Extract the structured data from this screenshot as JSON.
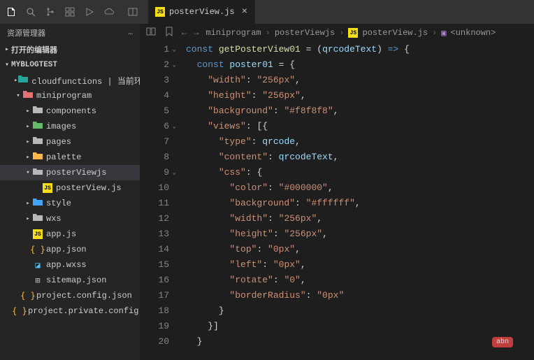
{
  "titlebar": {
    "tab_label": "posterView.js",
    "tab_close": "×"
  },
  "sidebar": {
    "title": "资源管理器",
    "menu_dots": "…",
    "sections": {
      "open_editors": "打开的编辑器",
      "project": "MYBLOGTEST"
    },
    "tree": [
      {
        "depth": 1,
        "arrow": "right",
        "icon": "folder-teal",
        "label": "cloudfunctions | 当前环境: blo…"
      },
      {
        "depth": 1,
        "arrow": "down",
        "icon": "folder-red",
        "label": "miniprogram"
      },
      {
        "depth": 2,
        "arrow": "right",
        "icon": "folder",
        "label": "components"
      },
      {
        "depth": 2,
        "arrow": "right",
        "icon": "folder-green",
        "label": "images"
      },
      {
        "depth": 2,
        "arrow": "right",
        "icon": "folder",
        "label": "pages"
      },
      {
        "depth": 2,
        "arrow": "right",
        "icon": "folder-orange",
        "label": "palette"
      },
      {
        "depth": 2,
        "arrow": "down",
        "icon": "folder-open",
        "label": "posterViewjs",
        "selected": true
      },
      {
        "depth": 3,
        "arrow": "none",
        "icon": "js",
        "label": "posterView.js"
      },
      {
        "depth": 2,
        "arrow": "right",
        "icon": "folder-blue",
        "label": "style"
      },
      {
        "depth": 2,
        "arrow": "right",
        "icon": "folder",
        "label": "wxs"
      },
      {
        "depth": 2,
        "arrow": "none",
        "icon": "js",
        "label": "app.js"
      },
      {
        "depth": 2,
        "arrow": "none",
        "icon": "json",
        "label": "app.json"
      },
      {
        "depth": 2,
        "arrow": "none",
        "icon": "wxss",
        "label": "app.wxss"
      },
      {
        "depth": 2,
        "arrow": "none",
        "icon": "sitemap",
        "label": "sitemap.json"
      },
      {
        "depth": 1,
        "arrow": "none",
        "icon": "json",
        "label": "project.config.json"
      },
      {
        "depth": 1,
        "arrow": "none",
        "icon": "json",
        "label": "project.private.config.json"
      }
    ]
  },
  "breadcrumb": {
    "items": [
      "miniprogram",
      "posterViewjs",
      "posterView.js",
      "<unknown>"
    ]
  },
  "code_lines": [
    [
      {
        "t": "kw",
        "v": "const "
      },
      {
        "t": "fn",
        "v": "getPosterView01"
      },
      {
        "t": "white",
        "v": " = "
      },
      {
        "t": "punc",
        "v": "("
      },
      {
        "t": "var",
        "v": "qrcodeText"
      },
      {
        "t": "punc",
        "v": ") "
      },
      {
        "t": "kw",
        "v": "=>"
      },
      {
        "t": "punc",
        "v": " {"
      }
    ],
    [
      {
        "t": "sp",
        "v": "  "
      },
      {
        "t": "kw",
        "v": "const "
      },
      {
        "t": "var",
        "v": "poster01"
      },
      {
        "t": "white",
        "v": " = "
      },
      {
        "t": "punc",
        "v": "{"
      }
    ],
    [
      {
        "t": "sp",
        "v": "    "
      },
      {
        "t": "str",
        "v": "\"width\""
      },
      {
        "t": "white",
        "v": ": "
      },
      {
        "t": "str",
        "v": "\"256px\""
      },
      {
        "t": "punc",
        "v": ","
      }
    ],
    [
      {
        "t": "sp",
        "v": "    "
      },
      {
        "t": "str",
        "v": "\"height\""
      },
      {
        "t": "white",
        "v": ": "
      },
      {
        "t": "str",
        "v": "\"256px\""
      },
      {
        "t": "punc",
        "v": ","
      }
    ],
    [
      {
        "t": "sp",
        "v": "    "
      },
      {
        "t": "str",
        "v": "\"background\""
      },
      {
        "t": "white",
        "v": ": "
      },
      {
        "t": "str",
        "v": "\"#f8f8f8\""
      },
      {
        "t": "punc",
        "v": ","
      }
    ],
    [
      {
        "t": "sp",
        "v": "    "
      },
      {
        "t": "str",
        "v": "\"views\""
      },
      {
        "t": "white",
        "v": ": "
      },
      {
        "t": "punc",
        "v": "[{"
      }
    ],
    [
      {
        "t": "sp",
        "v": "      "
      },
      {
        "t": "str",
        "v": "\"type\""
      },
      {
        "t": "white",
        "v": ": "
      },
      {
        "t": "var",
        "v": "qrcode"
      },
      {
        "t": "punc",
        "v": ","
      }
    ],
    [
      {
        "t": "sp",
        "v": "      "
      },
      {
        "t": "str",
        "v": "\"content\""
      },
      {
        "t": "white",
        "v": ": "
      },
      {
        "t": "var",
        "v": "qrcodeText"
      },
      {
        "t": "punc",
        "v": ","
      }
    ],
    [
      {
        "t": "sp",
        "v": "      "
      },
      {
        "t": "str",
        "v": "\"css\""
      },
      {
        "t": "white",
        "v": ": "
      },
      {
        "t": "punc",
        "v": "{"
      }
    ],
    [
      {
        "t": "sp",
        "v": "        "
      },
      {
        "t": "str",
        "v": "\"color\""
      },
      {
        "t": "white",
        "v": ": "
      },
      {
        "t": "str",
        "v": "\"#000000\""
      },
      {
        "t": "punc",
        "v": ","
      }
    ],
    [
      {
        "t": "sp",
        "v": "        "
      },
      {
        "t": "str",
        "v": "\"background\""
      },
      {
        "t": "white",
        "v": ": "
      },
      {
        "t": "str",
        "v": "\"#ffffff\""
      },
      {
        "t": "punc",
        "v": ","
      }
    ],
    [
      {
        "t": "sp",
        "v": "        "
      },
      {
        "t": "str",
        "v": "\"width\""
      },
      {
        "t": "white",
        "v": ": "
      },
      {
        "t": "str",
        "v": "\"256px\""
      },
      {
        "t": "punc",
        "v": ","
      }
    ],
    [
      {
        "t": "sp",
        "v": "        "
      },
      {
        "t": "str",
        "v": "\"height\""
      },
      {
        "t": "white",
        "v": ": "
      },
      {
        "t": "str",
        "v": "\"256px\""
      },
      {
        "t": "punc",
        "v": ","
      }
    ],
    [
      {
        "t": "sp",
        "v": "        "
      },
      {
        "t": "str",
        "v": "\"top\""
      },
      {
        "t": "white",
        "v": ": "
      },
      {
        "t": "str",
        "v": "\"0px\""
      },
      {
        "t": "punc",
        "v": ","
      }
    ],
    [
      {
        "t": "sp",
        "v": "        "
      },
      {
        "t": "str",
        "v": "\"left\""
      },
      {
        "t": "white",
        "v": ": "
      },
      {
        "t": "str",
        "v": "\"0px\""
      },
      {
        "t": "punc",
        "v": ","
      }
    ],
    [
      {
        "t": "sp",
        "v": "        "
      },
      {
        "t": "str",
        "v": "\"rotate\""
      },
      {
        "t": "white",
        "v": ": "
      },
      {
        "t": "str",
        "v": "\"0\""
      },
      {
        "t": "punc",
        "v": ","
      }
    ],
    [
      {
        "t": "sp",
        "v": "        "
      },
      {
        "t": "str",
        "v": "\"borderRadius\""
      },
      {
        "t": "white",
        "v": ": "
      },
      {
        "t": "str",
        "v": "\"0px\""
      }
    ],
    [
      {
        "t": "sp",
        "v": "      "
      },
      {
        "t": "punc",
        "v": "}"
      }
    ],
    [
      {
        "t": "sp",
        "v": "    "
      },
      {
        "t": "punc",
        "v": "}]"
      }
    ],
    [
      {
        "t": "sp",
        "v": "  "
      },
      {
        "t": "punc",
        "v": "}"
      }
    ]
  ],
  "fold_markers": [
    1,
    2,
    6,
    9
  ],
  "minimap_badge": "abn"
}
